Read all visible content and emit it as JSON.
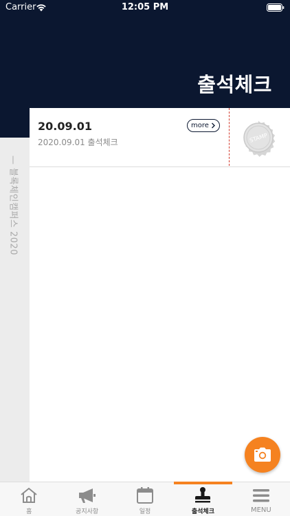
{
  "status_bar": {
    "carrier": "Carrier",
    "time": "12:05 PM"
  },
  "header": {
    "title": "출석체크"
  },
  "side_strip": {
    "text": "— 블록체인캠퍼스 2020"
  },
  "attendance_list": [
    {
      "date": "20.09.01",
      "description": "2020.09.01 출석체크",
      "more_label": "more",
      "stamp_text": "STAMP"
    }
  ],
  "colors": {
    "navy": "#0b1730",
    "accent": "#f58220",
    "dashed_line": "#d33a2c",
    "side_strip": "#ececec"
  },
  "tab_bar": {
    "tabs": [
      {
        "label": "홈",
        "icon": "home-icon"
      },
      {
        "label": "공지사항",
        "icon": "megaphone-icon"
      },
      {
        "label": "일정",
        "icon": "calendar-icon"
      },
      {
        "label": "출석체크",
        "icon": "stamp-icon",
        "active": true
      },
      {
        "label": "MENU",
        "icon": "menu-icon"
      }
    ]
  }
}
